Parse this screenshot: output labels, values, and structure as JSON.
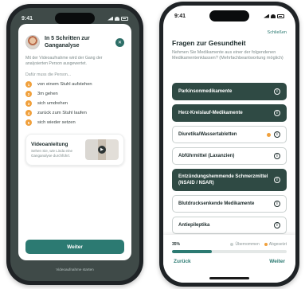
{
  "left": {
    "time": "9:41",
    "modal": {
      "title": "In 5 Schritten zur Ganganalyse",
      "description": "Mit der Videoaufnahme wird der Gang der analysierten Person ausgewertet.",
      "subheading": "Dafür muss die Person...",
      "steps": [
        {
          "num": "1",
          "text": "von einem Stuhl aufstehen"
        },
        {
          "num": "2",
          "text": "3m gehen"
        },
        {
          "num": "3",
          "text": "sich umdrehen"
        },
        {
          "num": "4",
          "text": "zurück zum Stuhl laufen"
        },
        {
          "num": "5",
          "text": "sich wieder setzen"
        }
      ],
      "video": {
        "title": "Videoanleitung",
        "description": "Sehen Sie, wie Linda eine Ganganalyse durchführt."
      }
    },
    "button_label": "Weiter",
    "footer_note": "Videoaufnahme starten"
  },
  "right": {
    "time": "9:41",
    "close_label": "Schließen",
    "title": "Fragen zur Gesundheit",
    "description": "Nehmen Sie Medikamente aus einer der folgendenen Medikamentenklassen? (Mehrfachbeantwortung möglich)",
    "options": [
      {
        "label": "Parkinsonmedikamente",
        "selected": true
      },
      {
        "label": "Herz-Kreislauf-Medikamente",
        "selected": true
      },
      {
        "label": "Diuretika/Wassertabletten",
        "selected": false,
        "pending": true
      },
      {
        "label": "Abführmittel (Laxanzien)",
        "selected": false
      },
      {
        "label": "Entzündungshemmende Schmerzmittel (NSAID / NSAR)",
        "selected": true
      },
      {
        "label": "Blutdrucksenkende Medikamente",
        "selected": false
      },
      {
        "label": "Antiepileptika",
        "selected": false
      }
    ],
    "progress": {
      "percent_label": "35%",
      "value": 0.35,
      "legend_taken": "Übernommen",
      "legend_open": "Abgesetzt"
    },
    "back_label": "Zurück",
    "next_label": "Weiter"
  },
  "colors": {
    "primary": "#2c7a72",
    "selected_bg": "#2f4a44",
    "accent_orange": "#f0a03c",
    "backdrop": "#3f4a48"
  }
}
